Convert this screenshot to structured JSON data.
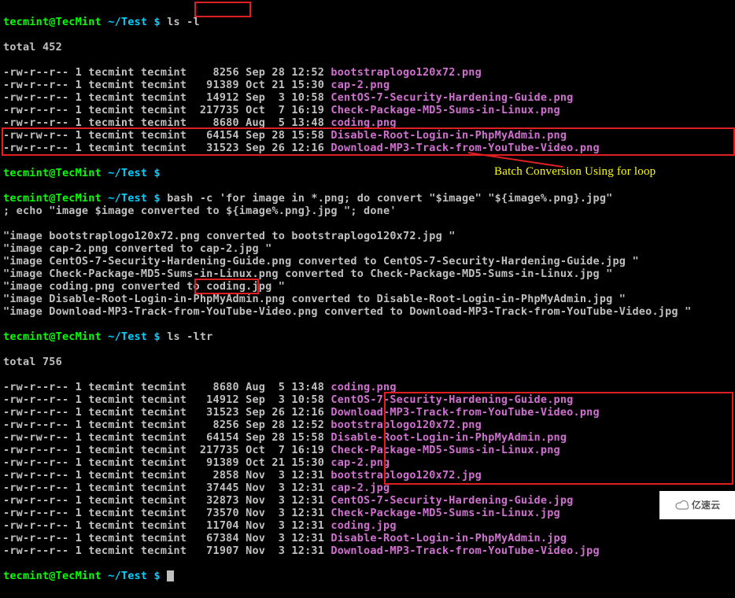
{
  "prompt": {
    "user": "tecmint",
    "host": "TecMint",
    "path": "~/Test",
    "dollar": "$"
  },
  "commands": {
    "ls_l": "ls -l",
    "bash_loop": "bash -c 'for image in *.png; do convert \"$image\" \"${image%.png}.jpg\"\n; echo \"image $image converted to ${image%.png}.jpg \"; done'",
    "ls_ltr": "ls -ltr"
  },
  "listing1": {
    "total": "total 452",
    "rows": [
      {
        "perm": "-rw-r--r--",
        "links": "1",
        "user": "tecmint",
        "group": "tecmint",
        "size": "8256",
        "date": "Sep 28 12:52",
        "name": "bootstraplogo120x72.png"
      },
      {
        "perm": "-rw-r--r--",
        "links": "1",
        "user": "tecmint",
        "group": "tecmint",
        "size": "91389",
        "date": "Oct 21 15:30",
        "name": "cap-2.png"
      },
      {
        "perm": "-rw-r--r--",
        "links": "1",
        "user": "tecmint",
        "group": "tecmint",
        "size": "14912",
        "date": "Sep  3 10:58",
        "name": "CentOS-7-Security-Hardening-Guide.png"
      },
      {
        "perm": "-rw-r--r--",
        "links": "1",
        "user": "tecmint",
        "group": "tecmint",
        "size": "217735",
        "date": "Oct  7 16:19",
        "name": "Check-Package-MD5-Sums-in-Linux.png"
      },
      {
        "perm": "-rw-r--r--",
        "links": "1",
        "user": "tecmint",
        "group": "tecmint",
        "size": "8680",
        "date": "Aug  5 13:48",
        "name": "coding.png"
      },
      {
        "perm": "-rw-rw-r--",
        "links": "1",
        "user": "tecmint",
        "group": "tecmint",
        "size": "64154",
        "date": "Sep 28 15:58",
        "name": "Disable-Root-Login-in-PhpMyAdmin.png"
      },
      {
        "perm": "-rw-r--r--",
        "links": "1",
        "user": "tecmint",
        "group": "tecmint",
        "size": "31523",
        "date": "Sep 26 12:16",
        "name": "Download-MP3-Track-from-YouTube-Video.png"
      }
    ]
  },
  "echo_lines": [
    "\"image bootstraplogo120x72.png converted to bootstraplogo120x72.jpg \"",
    "\"image cap-2.png converted to cap-2.jpg \"",
    "\"image CentOS-7-Security-Hardening-Guide.png converted to CentOS-7-Security-Hardening-Guide.jpg \"",
    "\"image Check-Package-MD5-Sums-in-Linux.png converted to Check-Package-MD5-Sums-in-Linux.jpg \"",
    "\"image coding.png converted to coding.jpg \"",
    "\"image Disable-Root-Login-in-PhpMyAdmin.png converted to Disable-Root-Login-in-PhpMyAdmin.jpg \"",
    "\"image Download-MP3-Track-from-YouTube-Video.png converted to Download-MP3-Track-from-YouTube-Video.jpg \""
  ],
  "listing2": {
    "total": "total 756",
    "rows": [
      {
        "perm": "-rw-r--r--",
        "links": "1",
        "user": "tecmint",
        "group": "tecmint",
        "size": "8680",
        "date": "Aug  5 13:48",
        "name": "coding.png"
      },
      {
        "perm": "-rw-r--r--",
        "links": "1",
        "user": "tecmint",
        "group": "tecmint",
        "size": "14912",
        "date": "Sep  3 10:58",
        "name": "CentOS-7-Security-Hardening-Guide.png"
      },
      {
        "perm": "-rw-r--r--",
        "links": "1",
        "user": "tecmint",
        "group": "tecmint",
        "size": "31523",
        "date": "Sep 26 12:16",
        "name": "Download-MP3-Track-from-YouTube-Video.png"
      },
      {
        "perm": "-rw-r--r--",
        "links": "1",
        "user": "tecmint",
        "group": "tecmint",
        "size": "8256",
        "date": "Sep 28 12:52",
        "name": "bootstraplogo120x72.png"
      },
      {
        "perm": "-rw-rw-r--",
        "links": "1",
        "user": "tecmint",
        "group": "tecmint",
        "size": "64154",
        "date": "Sep 28 15:58",
        "name": "Disable-Root-Login-in-PhpMyAdmin.png"
      },
      {
        "perm": "-rw-r--r--",
        "links": "1",
        "user": "tecmint",
        "group": "tecmint",
        "size": "217735",
        "date": "Oct  7 16:19",
        "name": "Check-Package-MD5-Sums-in-Linux.png"
      },
      {
        "perm": "-rw-r--r--",
        "links": "1",
        "user": "tecmint",
        "group": "tecmint",
        "size": "91389",
        "date": "Oct 21 15:30",
        "name": "cap-2.png"
      },
      {
        "perm": "-rw-r--r--",
        "links": "1",
        "user": "tecmint",
        "group": "tecmint",
        "size": "2858",
        "date": "Nov  3 12:31",
        "name": "bootstraplogo120x72.jpg"
      },
      {
        "perm": "-rw-r--r--",
        "links": "1",
        "user": "tecmint",
        "group": "tecmint",
        "size": "37445",
        "date": "Nov  3 12:31",
        "name": "cap-2.jpg"
      },
      {
        "perm": "-rw-r--r--",
        "links": "1",
        "user": "tecmint",
        "group": "tecmint",
        "size": "32873",
        "date": "Nov  3 12:31",
        "name": "CentOS-7-Security-Hardening-Guide.jpg"
      },
      {
        "perm": "-rw-r--r--",
        "links": "1",
        "user": "tecmint",
        "group": "tecmint",
        "size": "73570",
        "date": "Nov  3 12:31",
        "name": "Check-Package-MD5-Sums-in-Linux.jpg"
      },
      {
        "perm": "-rw-r--r--",
        "links": "1",
        "user": "tecmint",
        "group": "tecmint",
        "size": "11704",
        "date": "Nov  3 12:31",
        "name": "coding.jpg"
      },
      {
        "perm": "-rw-r--r--",
        "links": "1",
        "user": "tecmint",
        "group": "tecmint",
        "size": "67384",
        "date": "Nov  3 12:31",
        "name": "Disable-Root-Login-in-PhpMyAdmin.jpg"
      },
      {
        "perm": "-rw-r--r--",
        "links": "1",
        "user": "tecmint",
        "group": "tecmint",
        "size": "71907",
        "date": "Nov  3 12:31",
        "name": "Download-MP3-Track-from-YouTube-Video.jpg"
      }
    ]
  },
  "annotation": {
    "label": "Batch Conversion Using for loop"
  },
  "watermark": "亿速云"
}
